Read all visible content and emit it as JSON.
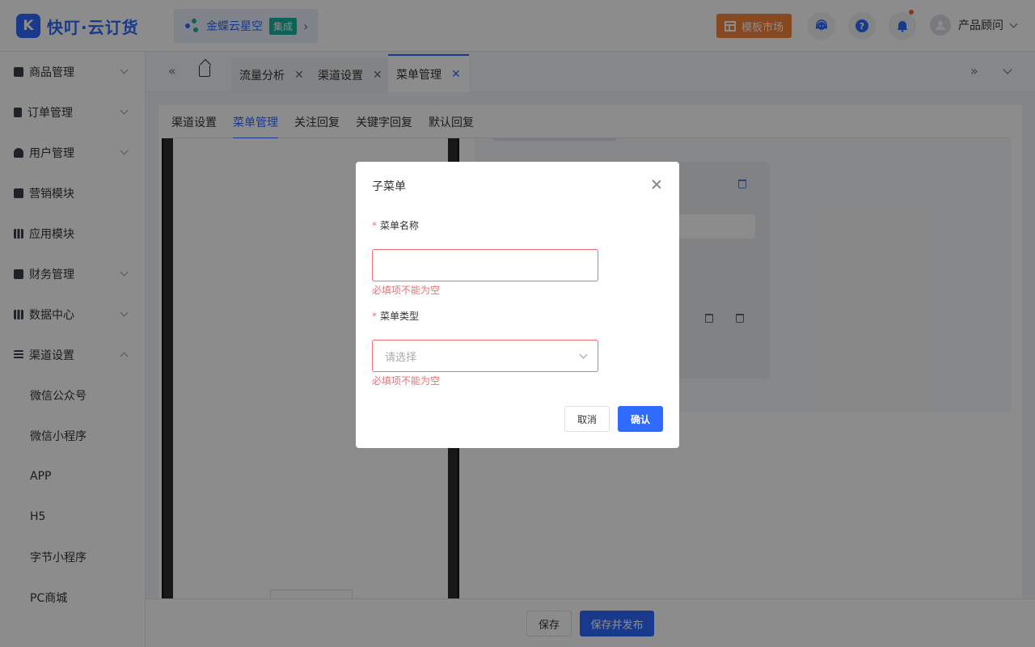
{
  "brand": {
    "logo_letter": "K",
    "name": "快叮·云订货"
  },
  "integration": {
    "name": "金蝶云星空",
    "badge": "集成"
  },
  "header": {
    "template_market": "模板市场",
    "help_glyph": "?",
    "user_name": "产品顾问"
  },
  "sidebar": {
    "items": [
      {
        "label": "商品管理",
        "expandable": true
      },
      {
        "label": "订单管理",
        "expandable": true
      },
      {
        "label": "用户管理",
        "expandable": true
      },
      {
        "label": "营销模块",
        "expandable": false
      },
      {
        "label": "应用模块",
        "expandable": false
      },
      {
        "label": "财务管理",
        "expandable": true
      },
      {
        "label": "数据中心",
        "expandable": true
      },
      {
        "label": "渠道设置",
        "expandable": true,
        "expanded": true
      }
    ],
    "sub_items": [
      "微信公众号",
      "微信小程序",
      "APP",
      "H5",
      "字节小程序",
      "PC商城"
    ]
  },
  "view_tabs": [
    {
      "label": "流量分析",
      "active": false
    },
    {
      "label": "渠道设置",
      "active": false
    },
    {
      "label": "菜单管理",
      "active": true
    }
  ],
  "sub_tabs": [
    {
      "label": "渠道设置",
      "active": false
    },
    {
      "label": "菜单管理",
      "active": true
    },
    {
      "label": "关注回复",
      "active": false
    },
    {
      "label": "关键字回复",
      "active": false
    },
    {
      "label": "默认回复",
      "active": false
    }
  ],
  "footer": {
    "save": "保存",
    "save_publish": "保存并发布"
  },
  "modal": {
    "title": "子菜单",
    "required_mark": "*",
    "name_label": "菜单名称",
    "name_value": "",
    "name_error": "必填项不能为空",
    "type_label": "菜单类型",
    "type_placeholder": "请选择",
    "type_error": "必填项不能为空",
    "cancel": "取消",
    "confirm": "确认"
  },
  "colors": {
    "accent": "#2f6bff",
    "error": "#f56c6c",
    "template_btn": "#f5833c",
    "integration_badge": "#1bb19b"
  }
}
